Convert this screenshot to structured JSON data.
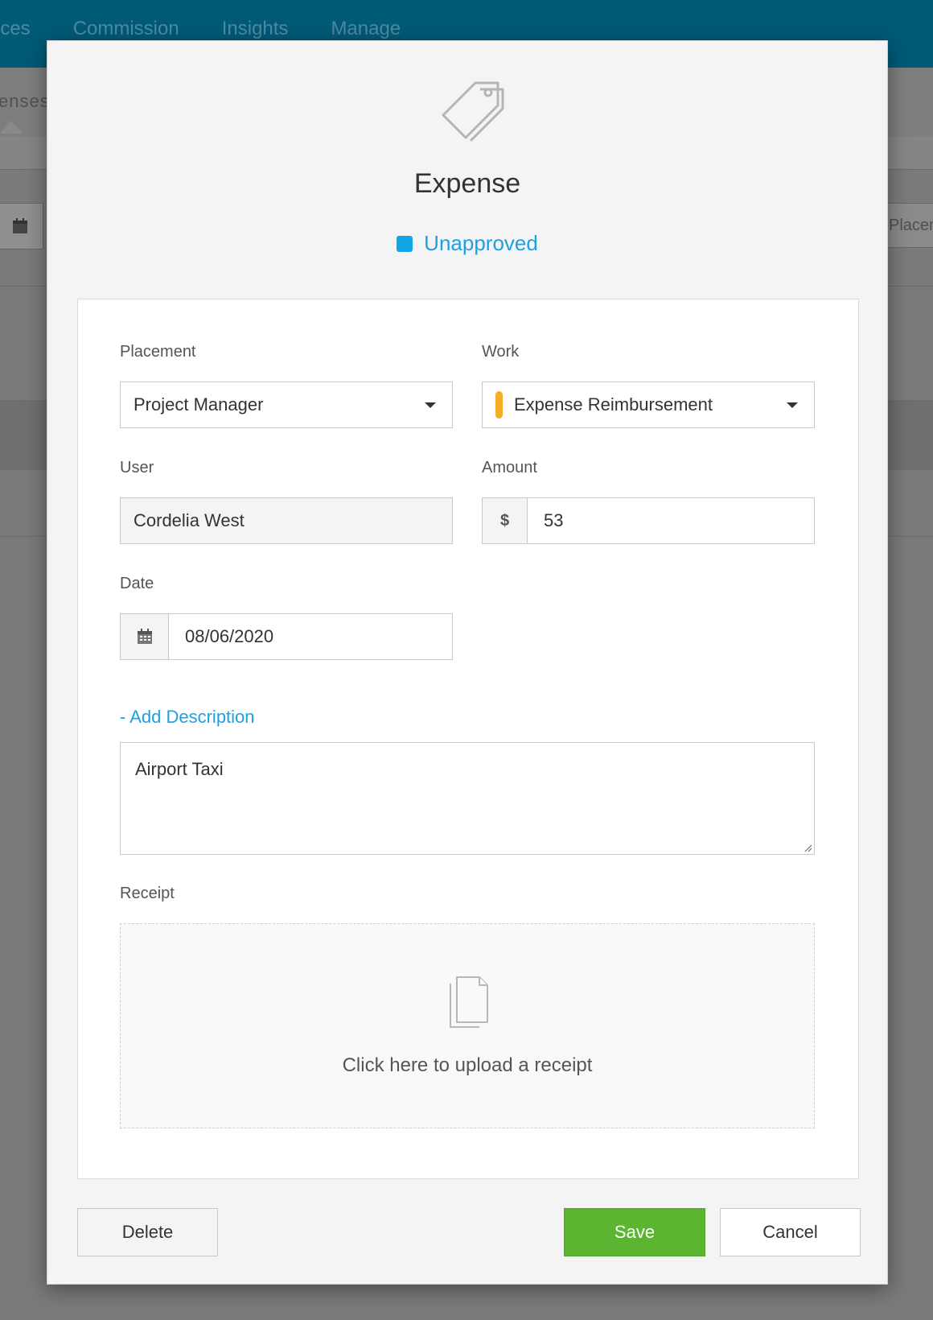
{
  "background": {
    "nav": [
      "ices",
      "Commission",
      "Insights",
      "Manage"
    ],
    "sub_label": "enses",
    "right_field": "Placem"
  },
  "modal": {
    "title": "Expense",
    "status": {
      "label": "Unapproved",
      "color": "#0fa5e8"
    },
    "form": {
      "placement": {
        "label": "Placement",
        "value": "Project Manager"
      },
      "work": {
        "label": "Work",
        "value": "Expense Reimbursement",
        "color": "#f7ad28"
      },
      "user": {
        "label": "User",
        "value": "Cordelia West"
      },
      "amount": {
        "label": "Amount",
        "currency": "$",
        "value": "53"
      },
      "date": {
        "label": "Date",
        "value": "08/06/2020"
      },
      "description": {
        "toggle_label": "- Add Description",
        "value": "Airport Taxi"
      },
      "receipt": {
        "label": "Receipt",
        "upload_text": "Click here to upload a receipt"
      }
    },
    "buttons": {
      "delete": "Delete",
      "save": "Save",
      "cancel": "Cancel"
    }
  }
}
